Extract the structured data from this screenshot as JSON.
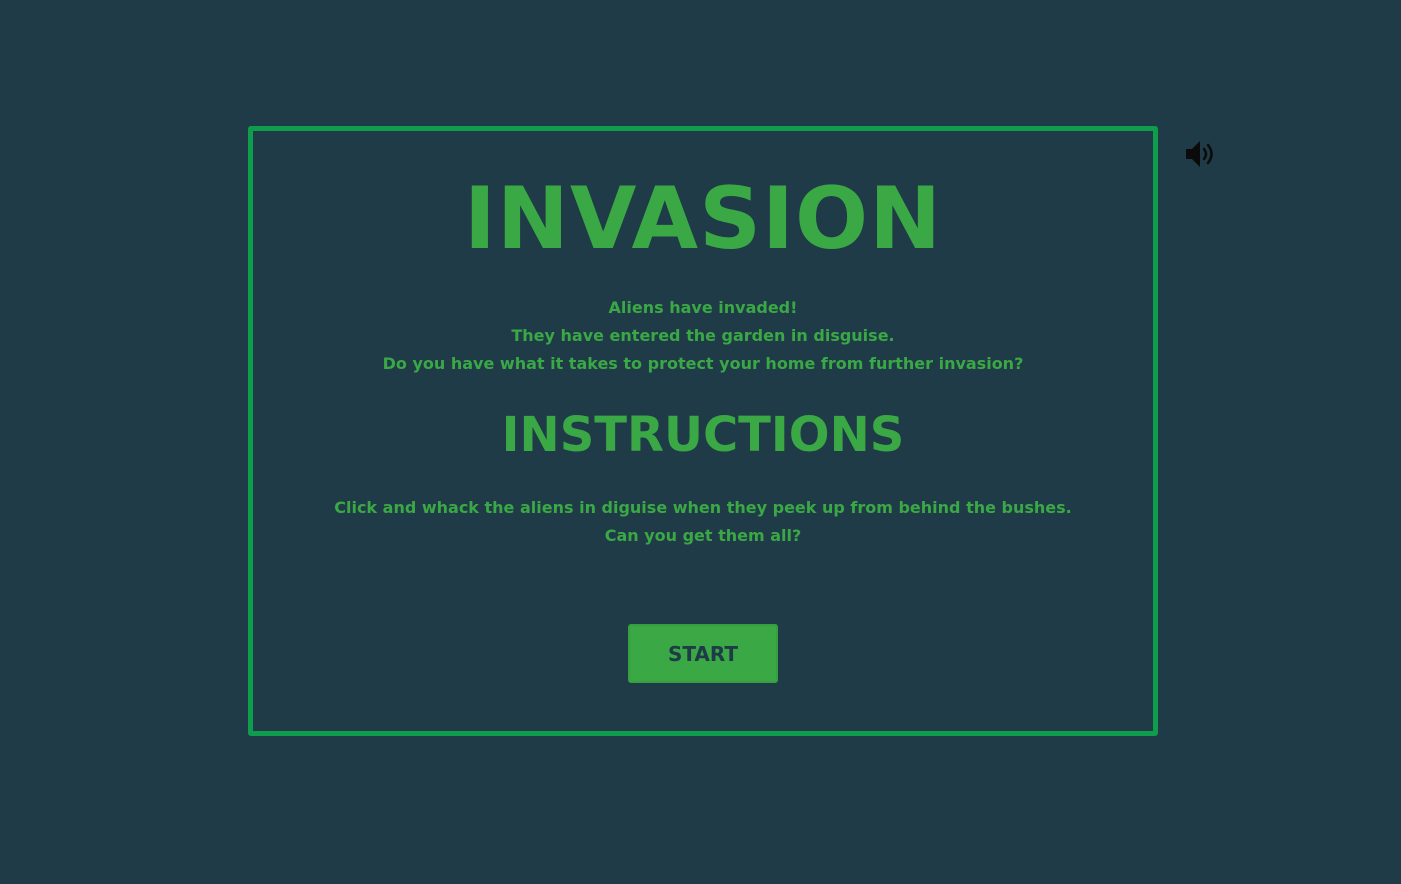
{
  "title": "INVASION",
  "intro_lines": [
    "Aliens have invaded!",
    "They have entered the garden in disguise.",
    "Do you have what it takes to protect your home from further invasion?"
  ],
  "instructions_heading": "INSTRUCTIONS",
  "instruction_lines": [
    "Click and whack the aliens in diguise when they peek up from behind the bushes.",
    "Can you get them all?"
  ],
  "start_label": "START",
  "sound_icon": "speaker-volume-icon",
  "colors": {
    "background": "#1f3b47",
    "border": "#0f9d4d",
    "text": "#3aa845",
    "button": "#3aa845",
    "button_text": "#1f3b47"
  }
}
